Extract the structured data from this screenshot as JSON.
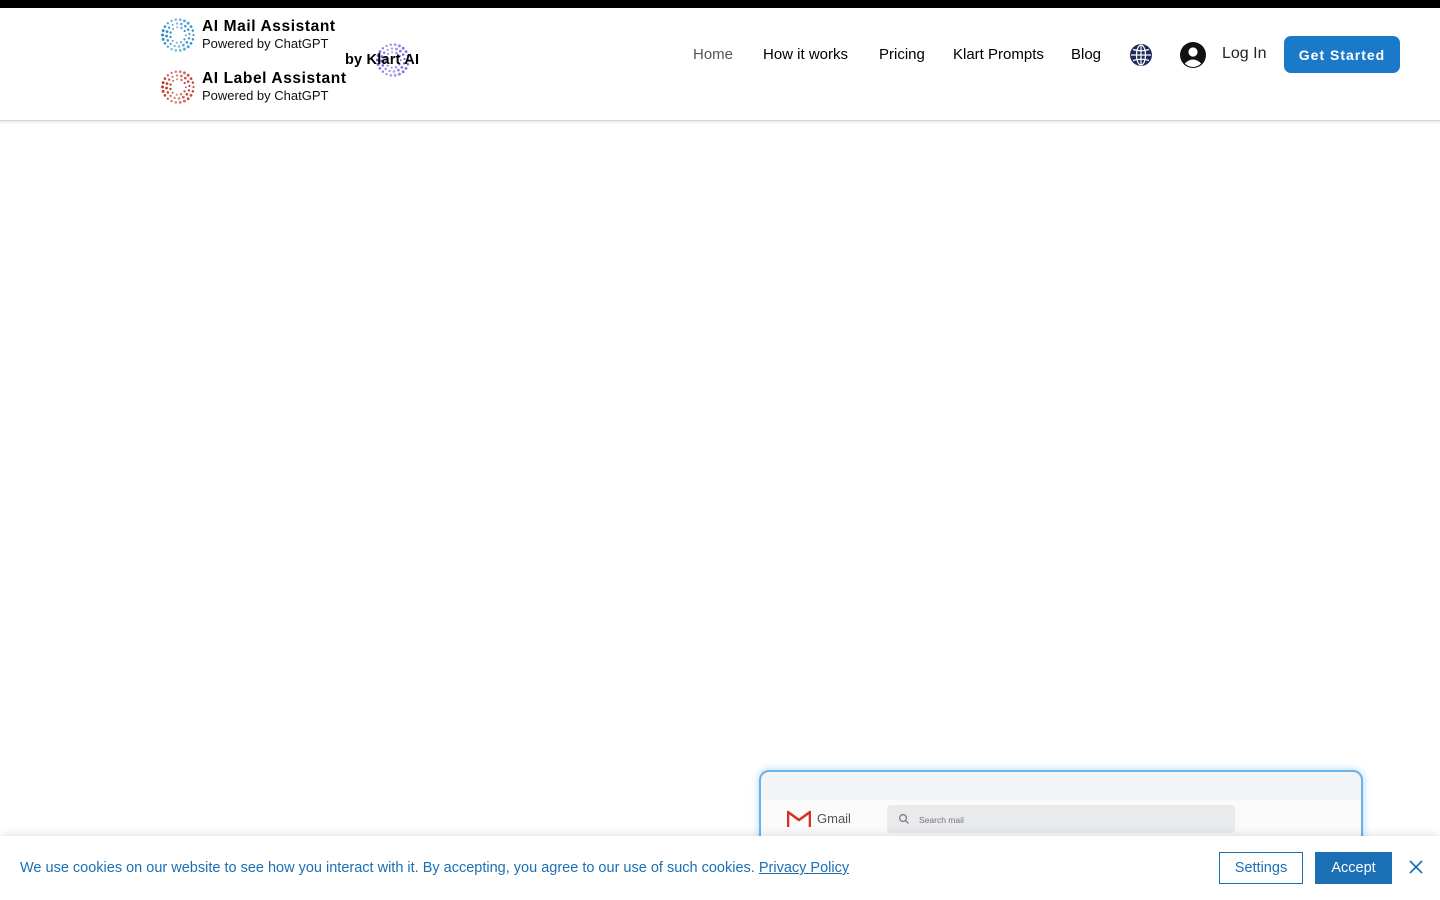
{
  "brands": {
    "mail": {
      "name": "AI Mail Assistant",
      "sub": "Powered by ChatGPT",
      "color": "#2a8ec9"
    },
    "label": {
      "name": "AI Label Assistant",
      "sub": "Powered by ChatGPT",
      "color": "#c0392b"
    },
    "byline": "by Klart AI",
    "klart_color": "#7a5ad8"
  },
  "nav": {
    "items": [
      {
        "label": "Home",
        "active": true
      },
      {
        "label": "How it works"
      },
      {
        "label": "Pricing"
      },
      {
        "label": "Klart Prompts"
      },
      {
        "label": "Blog"
      }
    ],
    "login_label": "Log In",
    "cta_label": "Get Started",
    "icons": [
      "globe-icon",
      "user-avatar-icon"
    ]
  },
  "preview": {
    "app_name": "Gmail",
    "search_placeholder": "Search mail"
  },
  "cookie": {
    "message": "We use cookies on our website to see how you interact with it. By accepting, you agree to our use of such cookies.",
    "policy_link": "Privacy Policy",
    "settings_label": "Settings",
    "accept_label": "Accept"
  },
  "colors": {
    "accent": "#1b79c9",
    "cookie_blue": "#1a6fb5",
    "nav_active": "#555555"
  }
}
